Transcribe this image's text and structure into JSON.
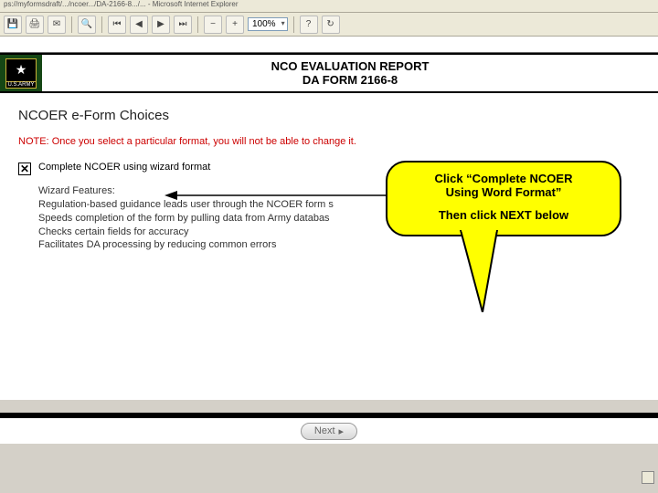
{
  "window": {
    "title": "ps://myformsdraft/.../ncoer.../DA-2166-8.../... - Microsoft Internet Explorer"
  },
  "toolbar": {
    "zoom": "100%"
  },
  "banner": {
    "line1": "NCO EVALUATION REPORT",
    "line2": "DA FORM 2166-8",
    "logo_label": "U.S.ARMY"
  },
  "page": {
    "section_title": "NCOER e-Form Choices",
    "note_label": "NOTE:",
    "note_text": "Once you select a particular format, you will not be able to change it.",
    "checkbox_label": "Complete NCOER using wizard format",
    "features_heading": "Wizard Features:",
    "features": [
      "Regulation-based guidance leads user through the NCOER form s",
      "Speeds completion of the form by pulling data from Army databas",
      "Checks certain fields for accuracy",
      "Facilitates DA processing by reducing common errors"
    ]
  },
  "callout": {
    "line1": "Click “Complete NCOER",
    "line2": "Using Word Format”",
    "line3": "Then click NEXT below"
  },
  "footer": {
    "next": "Next"
  }
}
